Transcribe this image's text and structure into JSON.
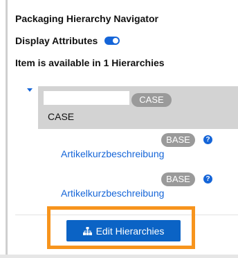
{
  "header": {
    "title": "Packaging Hierarchy Navigator"
  },
  "display_attributes": {
    "label": "Display Attributes",
    "enabled": true
  },
  "availability": {
    "text": "Item is available in 1 Hierarchies"
  },
  "tree": {
    "root": {
      "badge": "CASE",
      "name": "CASE"
    },
    "children": [
      {
        "badge": "BASE",
        "link": "Artikelkurzbeschreibung",
        "help_icon": "question-icon"
      },
      {
        "badge": "BASE",
        "link": "Artikelkurzbeschreibung",
        "help_icon": "question-icon"
      }
    ]
  },
  "actions": {
    "edit_label": "Edit Hierarchies",
    "edit_icon": "hierarchy-icon"
  },
  "colors": {
    "accent": "#1565d8",
    "button": "#0b63c5",
    "badge": "#9a9a9a",
    "highlight": "#f7941d",
    "selected_row": "#d3d3d3"
  }
}
